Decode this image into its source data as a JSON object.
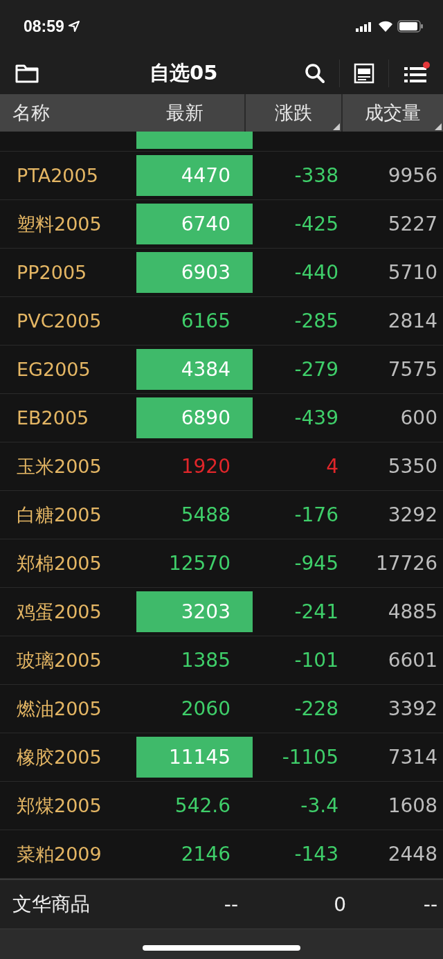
{
  "status_bar": {
    "time": "08:59"
  },
  "nav": {
    "title": "自选05",
    "badge_dot": true
  },
  "columns": [
    {
      "label": "名称",
      "sortable": false
    },
    {
      "label": "最新",
      "sortable": false
    },
    {
      "label": "涨跌",
      "sortable": true
    },
    {
      "label": "成交量",
      "sortable": true
    }
  ],
  "rows": [
    {
      "name": "PTA2005",
      "latest": "4470",
      "change": "-338",
      "volume": "9956",
      "color": "#3fcf6a",
      "highlighted": true
    },
    {
      "name": "塑料2005",
      "latest": "6740",
      "change": "-425",
      "volume": "5227",
      "color": "#3fcf6a",
      "highlighted": true
    },
    {
      "name": "PP2005",
      "latest": "6903",
      "change": "-440",
      "volume": "5710",
      "color": "#3fcf6a",
      "highlighted": true
    },
    {
      "name": "PVC2005",
      "latest": "6165",
      "change": "-285",
      "volume": "2814",
      "color": "#3fcf6a",
      "highlighted": false
    },
    {
      "name": "EG2005",
      "latest": "4384",
      "change": "-279",
      "volume": "7575",
      "color": "#3fcf6a",
      "highlighted": true
    },
    {
      "name": "EB2005",
      "latest": "6890",
      "change": "-439",
      "volume": "600",
      "color": "#3fcf6a",
      "highlighted": true
    },
    {
      "name": "玉米2005",
      "latest": "1920",
      "change": "4",
      "volume": "5350",
      "color": "#e0262a",
      "highlighted": false
    },
    {
      "name": "白糖2005",
      "latest": "5488",
      "change": "-176",
      "volume": "3292",
      "color": "#3fcf6a",
      "highlighted": false
    },
    {
      "name": "郑棉2005",
      "latest": "12570",
      "change": "-945",
      "volume": "17726",
      "color": "#3fcf6a",
      "highlighted": false
    },
    {
      "name": "鸡蛋2005",
      "latest": "3203",
      "change": "-241",
      "volume": "4885",
      "color": "#3fcf6a",
      "highlighted": true
    },
    {
      "name": "玻璃2005",
      "latest": "1385",
      "change": "-101",
      "volume": "6601",
      "color": "#3fcf6a",
      "highlighted": false
    },
    {
      "name": "燃油2005",
      "latest": "2060",
      "change": "-228",
      "volume": "3392",
      "color": "#3fcf6a",
      "highlighted": false
    },
    {
      "name": "橡胶2005",
      "latest": "11145",
      "change": "-1105",
      "volume": "7314",
      "color": "#3fcf6a",
      "highlighted": true
    },
    {
      "name": "郑煤2005",
      "latest": "542.6",
      "change": "-3.4",
      "volume": "1608",
      "color": "#3fcf6a",
      "highlighted": false
    },
    {
      "name": "菜粕2009",
      "latest": "2146",
      "change": "-143",
      "volume": "2448",
      "color": "#3fcf6a",
      "highlighted": false
    }
  ],
  "footer": {
    "name": "文华商品",
    "latest": "--",
    "change": "0",
    "volume": "--"
  }
}
